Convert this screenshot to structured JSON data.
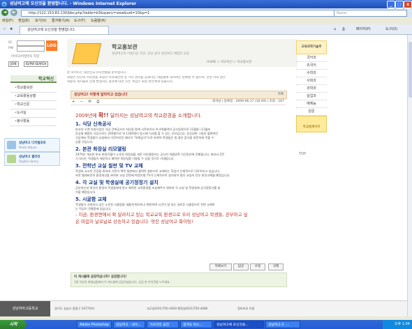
{
  "window": {
    "title": "성남여고에 오신것을 환영합니다. - Windows Internet Explorer",
    "min": "_",
    "max": "□",
    "close": "x"
  },
  "address": {
    "url": "http://122.153.83.130/bbs.php?table=b3&query=view&uid=10&p=1",
    "search_placeholder": "Naver"
  },
  "menu": [
    "파일(F)",
    "편집(E)",
    "보기(V)",
    "즐겨찾기(A)",
    "도구(T)",
    "도움말(H)"
  ],
  "tab": {
    "label": "성남여고에 오신것을 환영합니다."
  },
  "toolbar": {
    "page": "페이지(P)",
    "tools": "도구(O)"
  },
  "sidebar": {
    "login_id_label": "ID",
    "login_pw_label": "PW",
    "login_button": "LOG",
    "save_id": "아이디/비밀번호 저장",
    "join": "JOIN",
    "search_id": "ID/PW SEARCH",
    "menu_title": "학교혁신",
    "items": [
      "학교홍보관",
      "교육활동상황",
      "학교신문",
      "도서실",
      "봉사활동"
    ],
    "banner1_title": "성남여고 디지털포토",
    "banner1_sub": "Photo Album",
    "banner2_title": "성남여고 갤러리",
    "banner2_sub": "Digital Library"
  },
  "header": {
    "title": "학교홍보관",
    "subtitle": "성남여고의 아름다운 학교, 만남 같이 성남여고 체험한 교실",
    "breadcrumb": "HOME > 학교혁신 > 학교홍보관"
  },
  "notice": [
    "본 사이트는 대한민국 저작권법을 준수합니다.",
    "회원은 타인의 저작권을 포함한 지적재산권 및 기타 권리를 침해하는 내용물에 대하여는 등록할 수 없으며, 만일 이와 같은",
    "내용의 게시물로 인해 발생하는 결과에 대한 모든 책임은 회원 본인에게 있습니다."
  ],
  "post": {
    "subject": "성남여고! 이렇게 달라지고 있습니다",
    "list_label": "목록",
    "icons": "+ − ✉ ⎙",
    "meta": "최석남 | 등록일 : 2009.06.17 (16:49) | 조회 : 167",
    "heading_pre": "2009년에 ",
    "heading_wow": "확!!",
    "heading_post": " 달라지는 성남여고의 학교환경을 소개합니다.",
    "sections": [
      {
        "title": "1. 식당 신축공사",
        "lines": [
          "본교의 오랜 숙원사업인 식당 건축공사가 지난달 말에 시작되어서 약 4개월여의 공사일정으로 11월말~11월초",
          "준공될 예정인 식당규모는 200평으로 약 1200명이 동시에 식사를 할 수 있는 규모입니다. 준공되면 그동안 불편하던",
          "식당에서 학생들이 교실에서 이루어지던 배식이 \"자해급식\"으로 바뀌어 학생들은 질 좋은 음식을 따뜻하게 먹을 수",
          "있을 것입니다."
        ]
      },
      {
        "title": "2. 본관 화장실 리모델링",
        "lines": [
          "1970년 개교한 본교 본관건물이 노후된 화장실을 새로 리모델링하는 공사가 여름방학 기간동안에 진행됩니다. 따라서 2학",
          "기 부터는 학생들이 깨끗하고 쾌적한 화장실을 이용할 수 있을 것으로 기대합니다."
        ]
      },
      {
        "title": "3. 전학년 교실 칠판 및 TV 교체",
        "lines": [
          "학생과 교사의 건강을 위하여 기존의 백묵 칠판에서 물백묵 칠판으로 교체하는 작업이 단계적으로 이루어지고 있습니다.",
          "또한 텔레비전의 환경개선을 위하여 교실 전면에 벽걸이형 TV가 단계적으로 설치되어 향후 교실의 전부 완전교체될 예정입니다."
        ]
      },
      {
        "title": "4. 각 교실 및 학생실에 공기정정기 설치",
        "lines": [
          "공부하는데 최선의 환경의 학생들에게 맑고 쾌적한 교육환경을 조성해주기 위하여 각 교실 및 학생실에 공기정정기를 설",
          "치할 예정입니다."
        ]
      },
      {
        "title": "5. 시굴함 교체",
        "lines": [
          "학생들이 사용하고 있는 노후된 사물함을 새롭게 편리하고 편한하며 시건이 잘 되는 새로운 사물함으로 전면 교체하",
          "는 작업이 진행중에 있습니다."
        ]
      }
    ],
    "closing1": "- 지금, 환경면에서 확 달라지고 있는 학교교육 환경으로 우리 성남여고 학생들, 공부하고 싶",
    "closing2": "은 마음이 날로날로 상승하고 있습니다. 멋진 성남여고 화이팅!"
  },
  "actions": [
    "목록보기",
    "답글",
    "수정",
    "삭제"
  ],
  "comment": {
    "line1": "이 게시물에 공감하십니까? 공감합니다!",
    "line2": "1명 이상의 회원님들께서 이 게시물에 공감하셨습니다. 공감 한 아이콘을 누르세요."
  },
  "footer": {
    "logo": "성남여자고등학교",
    "address": "경기도 성남시 중원구 2477번지",
    "tel": "교무실(031)750-4400 행정실(031)750-4480",
    "privacy": "정보보호 이용"
  },
  "rightpanel": {
    "head": "교육과학기술부",
    "items": [
      "국어과",
      "외국어",
      "수학과",
      "사회과",
      "과학과",
      "실업과",
      "예체능",
      "원문"
    ],
    "foot": "학교홈페이지",
    "top": "TOP"
  },
  "taskbar": {
    "start": "시작",
    "tasks": [
      "Adobe Photoshop",
      "성남여고 - 내이...",
      "가으리리 공천",
      "생겨도 버스...",
      "성남여고에 오신것을...",
      "성남여고-3 -..."
    ],
    "clock": "오후 1:04"
  }
}
